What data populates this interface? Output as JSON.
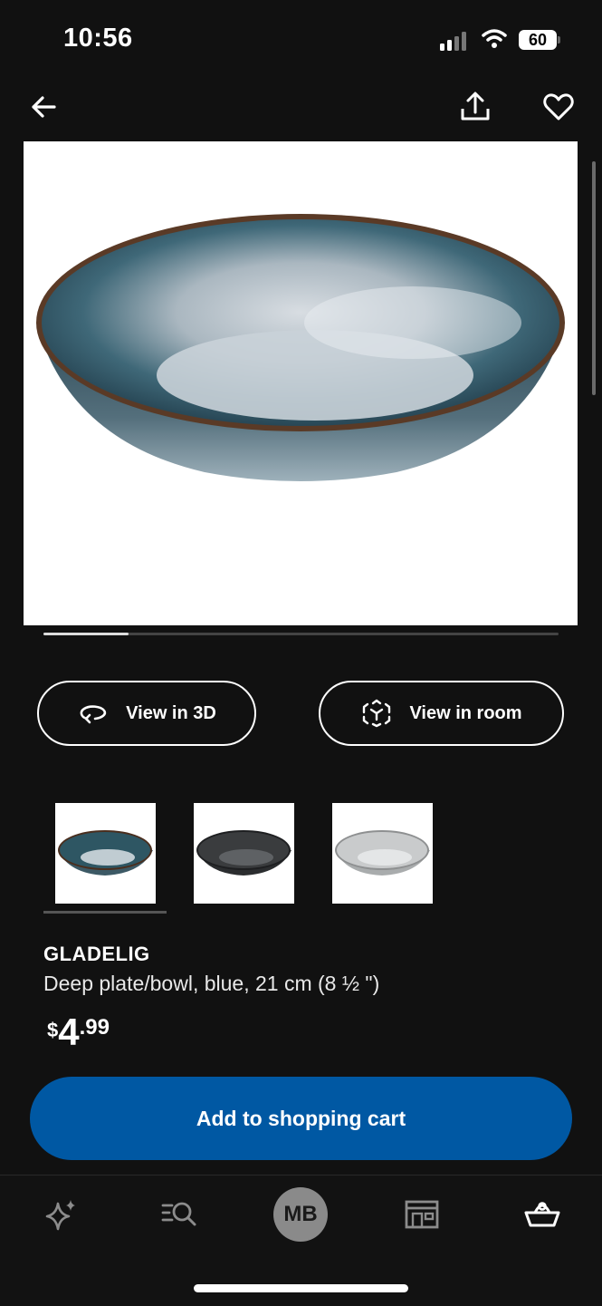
{
  "status_bar": {
    "time": "10:56",
    "battery": "60"
  },
  "nav": {
    "back_icon": "arrow-left-icon",
    "share_icon": "share-icon",
    "favorite_icon": "heart-icon"
  },
  "actions": {
    "view_3d_label": "View in 3D",
    "view_room_label": "View in room"
  },
  "thumbnails": [
    {
      "name": "blue",
      "color": "#2e5663",
      "selected": true
    },
    {
      "name": "dark grey",
      "color": "#3a3c3e",
      "selected": false
    },
    {
      "name": "light grey",
      "color": "#c9cbcc",
      "selected": false
    }
  ],
  "product": {
    "name": "GLADELIG",
    "description": "Deep plate/bowl, blue, 21 cm (8 ½ \")",
    "price": {
      "currency": "$",
      "integer": "4",
      "decimal": ".99"
    }
  },
  "cart_button_label": "Add to shopping cart",
  "tab_bar": {
    "items": [
      "sparkle-icon",
      "search-icon",
      "avatar",
      "store-icon",
      "basket-icon"
    ],
    "avatar_initials": "MB"
  },
  "colors": {
    "accent": "#0058a3",
    "background": "#111111"
  }
}
